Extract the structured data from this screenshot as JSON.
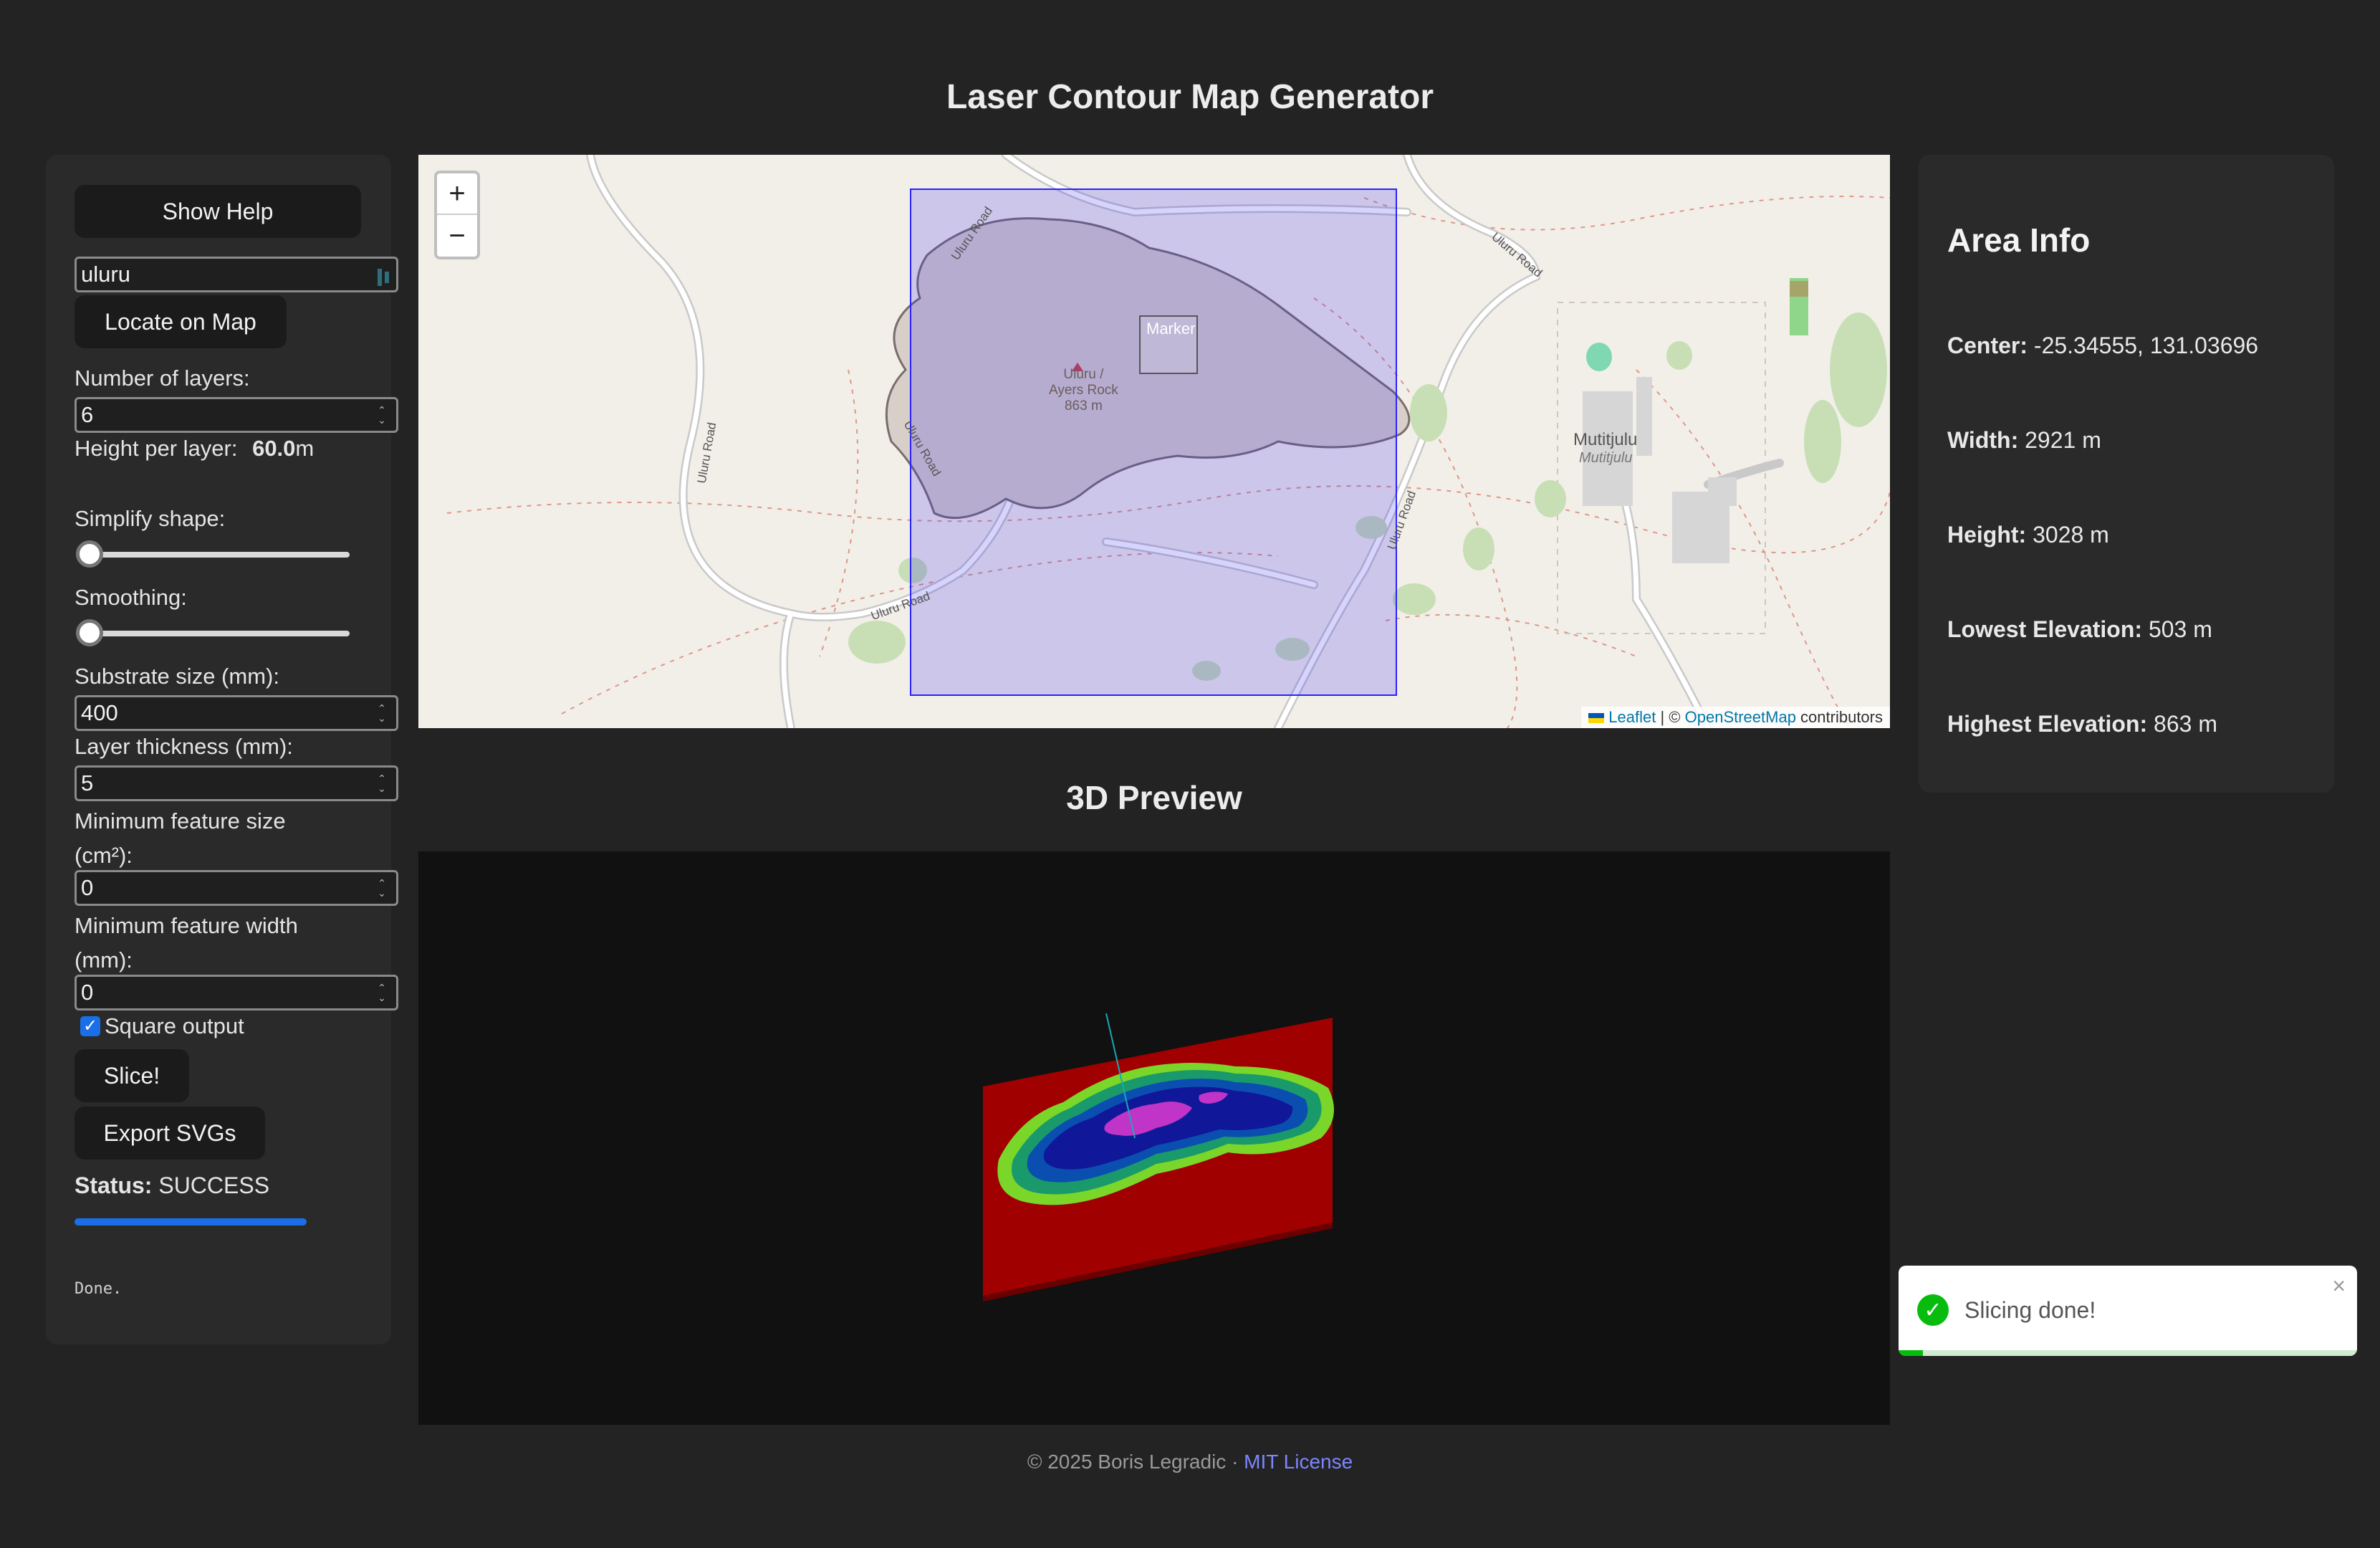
{
  "header": {
    "title": "Laser Contour Map Generator"
  },
  "controls": {
    "show_help": "Show Help",
    "search_value": "uluru",
    "locate_button": "Locate on Map",
    "layers_label": "Number of layers:",
    "layers_value": "6",
    "height_per_layer_label": "Height per layer:",
    "height_per_layer_value": "60.0",
    "height_per_layer_unit": "m",
    "simplify_label": "Simplify shape:",
    "simplify_value": 0,
    "smoothing_label": "Smoothing:",
    "smoothing_value": 0,
    "substrate_label": "Substrate size (mm):",
    "substrate_value": "400",
    "thickness_label": "Layer thickness (mm):",
    "thickness_value": "5",
    "min_size_label_line1": "Minimum feature size",
    "min_size_label_line2": "(cm²):",
    "min_size_value": "0",
    "min_width_label_line1": "Minimum feature width",
    "min_width_label_line2": "(mm):",
    "min_width_value": "0",
    "square_output_label": "Square output",
    "square_output_checked": true,
    "slice_button": "Slice!",
    "export_button": "Export SVGs",
    "status_label": "Status:",
    "status_value": "SUCCESS",
    "progress_percent": 100,
    "log_text": "Done."
  },
  "map": {
    "zoom_in": "+",
    "zoom_out": "−",
    "marker_label": "Marker",
    "place_labels": {
      "uluru_name1": "Uluru /",
      "uluru_name2": "Ayers Rock",
      "uluru_elev": "863 m",
      "mutitjulu": "Mutitjulu",
      "mutitjulu_alt": "Mutitjulu",
      "road1": "Uluru Road",
      "road2": "Uluru Road",
      "road3": "Uluru Road",
      "road4": "Uluru Road",
      "road5": "Uluru Road",
      "road6": "Uluru Road"
    },
    "attribution": {
      "leaflet": "Leaflet",
      "sep": " | © ",
      "osm": "OpenStreetMap",
      "suffix": " contributors"
    }
  },
  "preview": {
    "title": "3D Preview"
  },
  "area_info": {
    "title": "Area Info",
    "center_label": "Center:",
    "center_value": "-25.34555, 131.03696",
    "width_label": "Width:",
    "width_value": "2921 m",
    "height_label": "Height:",
    "height_value": "3028 m",
    "lowest_label": "Lowest Elevation:",
    "lowest_value": "503 m",
    "highest_label": "Highest Elevation:",
    "highest_value": "863 m"
  },
  "toast": {
    "message": "Slicing done!",
    "close": "×",
    "check": "✓"
  },
  "footer": {
    "copyright": "© 2025 Boris Legradic · ",
    "license": "MIT License"
  },
  "colors": {
    "background": "#232323",
    "panel": "#2a2a2a",
    "selection_fill": "#bebdf2",
    "selection_border": "#3333ff",
    "progress": "#1a6fe8",
    "toast_success": "#07bc0c",
    "preview_base": "#a00000"
  }
}
